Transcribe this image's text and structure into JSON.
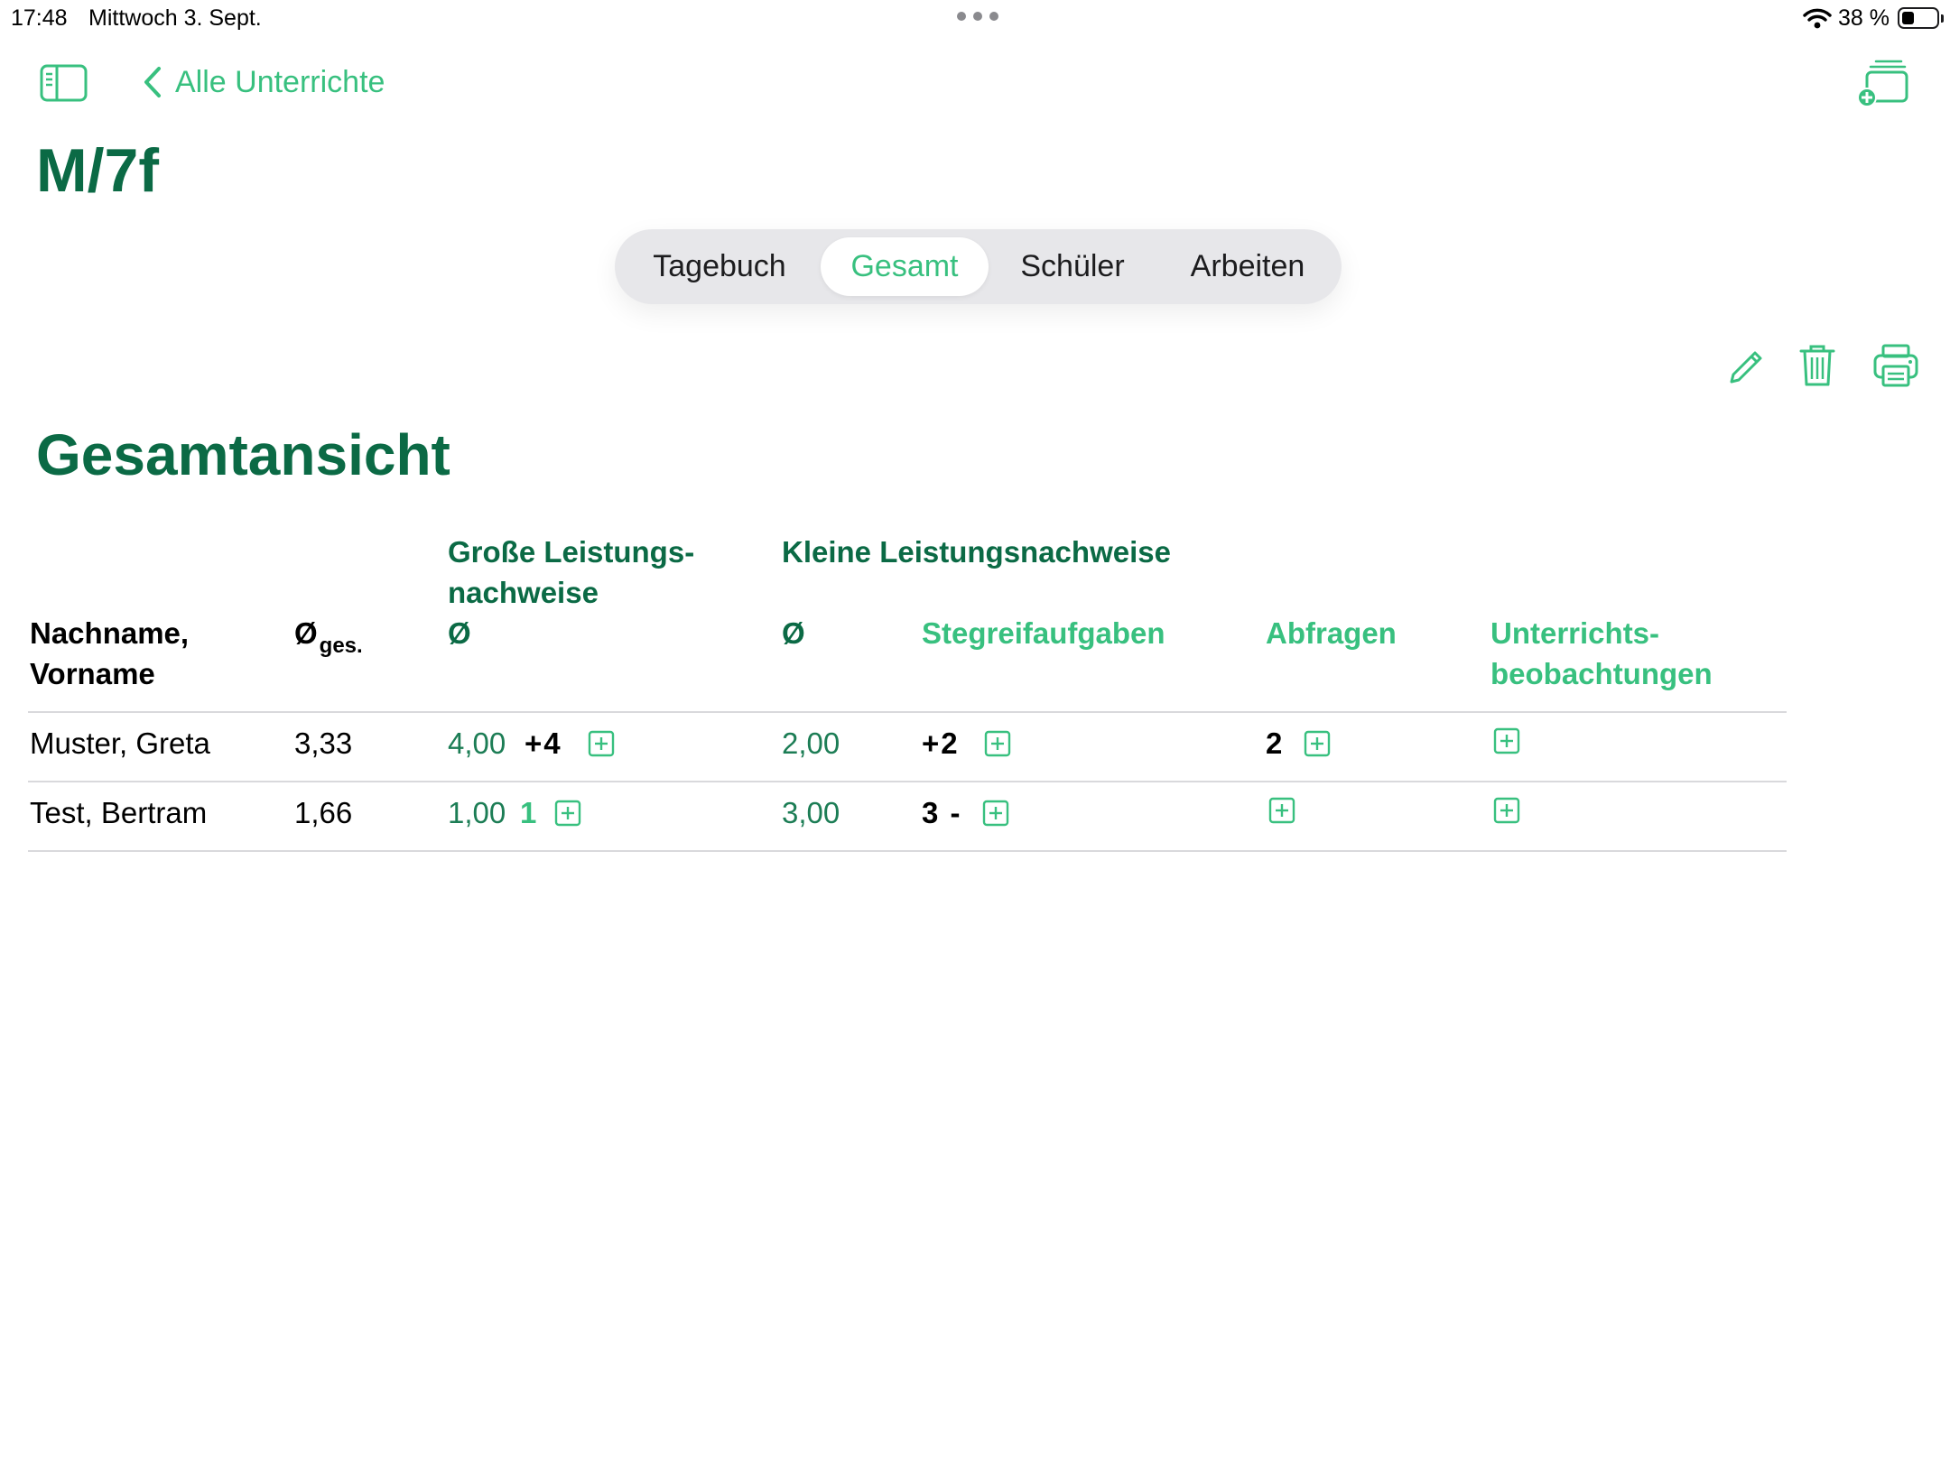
{
  "status_bar": {
    "time": "17:48",
    "date": "Mittwoch 3. Sept.",
    "battery": "38 %",
    "battery_level": 0.38
  },
  "nav": {
    "back_label": "Alle Unterrichte",
    "title": "M/7f"
  },
  "tabs": [
    {
      "label": "Tagebuch",
      "active": false
    },
    {
      "label": "Gesamt",
      "active": true
    },
    {
      "label": "Schüler",
      "active": false
    },
    {
      "label": "Arbeiten",
      "active": false
    }
  ],
  "toolbar": {
    "icons": [
      "pencil-icon",
      "trash-icon",
      "printer-icon"
    ]
  },
  "section_title": "Gesamtansicht",
  "table": {
    "group_headers": {
      "grosse": "Große Leistungs-\nnachweise",
      "kleine": "Kleine Leistungsnachweise"
    },
    "columns": {
      "name": "Nachname,\nVorname",
      "avg_symbol": "Ø",
      "avg_sub": "ges.",
      "grosse_avg": "Ø",
      "kleine_avg": "Ø",
      "stegreif": "Stegreifaufgaben",
      "abfragen": "Abfragen",
      "unterricht": "Unterrichts-\nbeobachtungen"
    },
    "rows": [
      {
        "name": "Muster, Greta",
        "avg_total": "3,33",
        "grosse_avg": "4,00",
        "grosse_grade": "+4",
        "kleine_avg": "2,00",
        "stegreif_grade": "+2",
        "abfragen_grade": "2",
        "unterricht_grade": ""
      },
      {
        "name": "Test, Bertram",
        "avg_total": "1,66",
        "grosse_avg": "1,00",
        "grosse_grade": "1",
        "kleine_avg": "3,00",
        "stegreif_grade": "3 -",
        "abfragen_grade": "",
        "unterricht_grade": ""
      }
    ]
  },
  "colors": {
    "accent": "#38c07f",
    "title_green": "#0b6a45",
    "value_green": "#1c7d55"
  }
}
